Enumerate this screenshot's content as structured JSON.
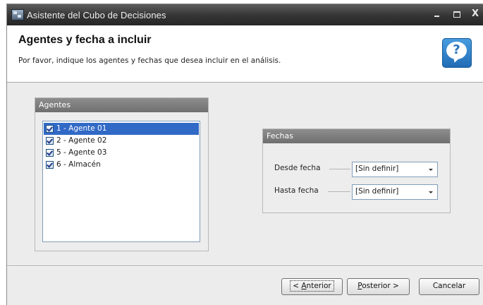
{
  "window": {
    "title": "Asistente del Cubo de Decisiones",
    "minimize_glyph": "",
    "maximize_glyph": "",
    "close_glyph": "X"
  },
  "header": {
    "title": "Agentes y fecha a incluir",
    "subtitle": "Por favor, indique los agentes y fechas que desea incluir en el análisis.",
    "help_glyph": "?"
  },
  "agentes": {
    "title": "Agentes",
    "items": [
      {
        "label": "1 - Agente 01",
        "checked": true,
        "selected": true
      },
      {
        "label": "2 - Agente 02",
        "checked": true,
        "selected": false
      },
      {
        "label": "5 - Agente 03",
        "checked": true,
        "selected": false
      },
      {
        "label": "6 - Almacén",
        "checked": true,
        "selected": false
      }
    ]
  },
  "fechas": {
    "title": "Fechas",
    "desde_label": "Desde fecha",
    "desde_value": "[Sin definir]",
    "hasta_label": "Hasta fecha",
    "hasta_value": "[Sin definir]"
  },
  "footer": {
    "anterior_prefix": "< ",
    "anterior_accel": "A",
    "anterior_rest": "nterior",
    "posterior_accel": "P",
    "posterior_rest": "osterior >",
    "cancelar_label": "Cancelar"
  },
  "colors": {
    "title_bar": "#343434",
    "selection": "#3169c6",
    "group_header": "#7f7f7f",
    "help_icon": "#2a7fcf"
  }
}
